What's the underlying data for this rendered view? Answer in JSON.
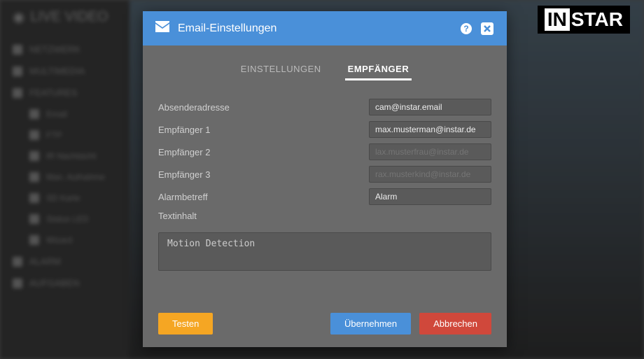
{
  "logo": {
    "part1": "IN",
    "part2": "STAR"
  },
  "sidebar": {
    "title": "LIVE VIDEO",
    "items": [
      {
        "label": "NETZWERK"
      },
      {
        "label": "MULTIMEDIA"
      },
      {
        "label": "FEATURES"
      },
      {
        "label": "Email",
        "sub": true
      },
      {
        "label": "FTP",
        "sub": true
      },
      {
        "label": "IR Nachtsicht",
        "sub": true
      },
      {
        "label": "Man. Aufnahme",
        "sub": true
      },
      {
        "label": "SD Karte",
        "sub": true
      },
      {
        "label": "Status LED",
        "sub": true
      },
      {
        "label": "Wizard",
        "sub": true
      },
      {
        "label": "ALARM"
      },
      {
        "label": "AUFGABEN"
      }
    ]
  },
  "modal": {
    "title": "Email-Einstellungen",
    "tabs": {
      "settings": "EINSTELLUNGEN",
      "recipients": "EMPFÄNGER"
    },
    "fields": {
      "sender_label": "Absenderadresse",
      "sender_value": "cam@instar.email",
      "r1_label": "Empfänger 1",
      "r1_value": "max.musterman@instar.de",
      "r2_label": "Empfänger 2",
      "r2_placeholder": "lax.musterfrau@instar.de",
      "r3_label": "Empfänger 3",
      "r3_placeholder": "rax.musterkind@instar.de",
      "subject_label": "Alarmbetreff",
      "subject_value": "Alarm",
      "body_label": "Textinhalt",
      "body_value": "Motion Detection"
    },
    "buttons": {
      "test": "Testen",
      "apply": "Übernehmen",
      "cancel": "Abbrechen"
    }
  }
}
